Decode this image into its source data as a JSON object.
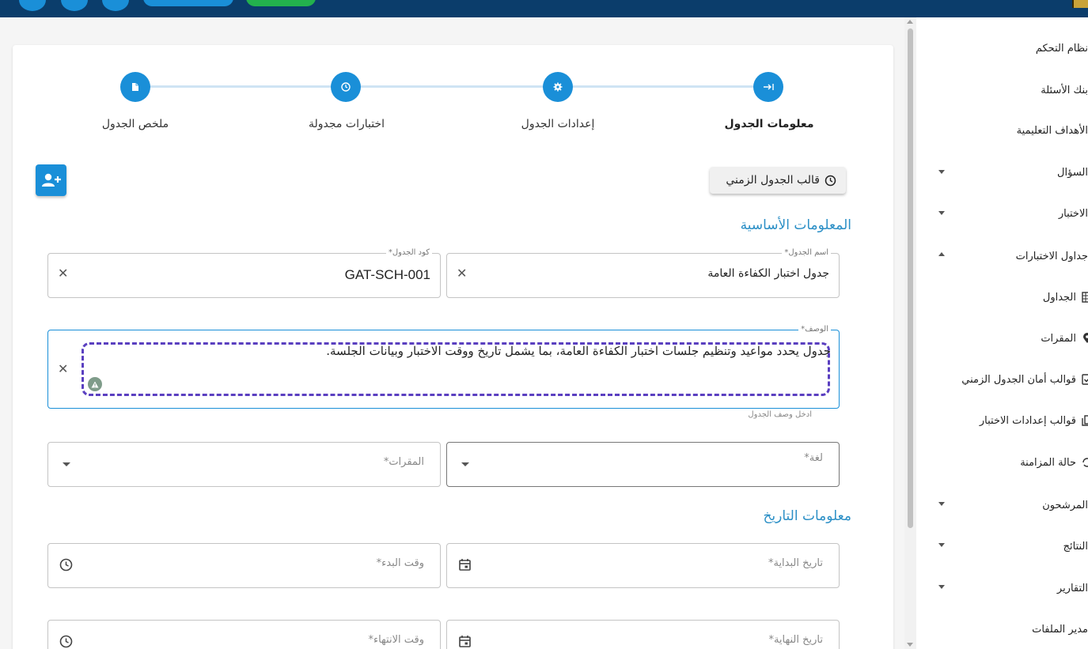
{
  "stepper": {
    "steps": [
      {
        "label": "معلومات الجدول",
        "icon": "arrow-right-to-line-icon",
        "active": true
      },
      {
        "label": "إعدادات الجدول",
        "icon": "gear-icon",
        "active": false
      },
      {
        "label": "اختبارات مجدولة",
        "icon": "clock-icon",
        "active": false
      },
      {
        "label": "ملخص الجدول",
        "icon": "document-icon",
        "active": false
      }
    ]
  },
  "toolbar": {
    "template_button_label": "قالب الجدول الزمني"
  },
  "sections": {
    "basic_info": "المعلومات الأساسية",
    "date_info": "معلومات التاريخ"
  },
  "fields": {
    "schedule_name": {
      "label": "اسم الجدول*",
      "value": "جدول اختبار الكفاءة العامة"
    },
    "schedule_code": {
      "label": "كود الجدول*",
      "value": "GAT-SCH-001"
    },
    "description": {
      "label": "الوصف*",
      "value": "جدول يحدد مواعيد وتنظيم جلسات اختبار الكفاءة العامة، بما يشمل تاريخ ووقت الاختبار وبيانات الجلسة.",
      "helper": "ادخل وصف الجدول"
    },
    "language": {
      "placeholder": "لغة*"
    },
    "venues": {
      "placeholder": "المقرات*"
    },
    "start_date": {
      "placeholder": "تاريخ البداية*"
    },
    "start_time": {
      "placeholder": "وقت البدء*"
    },
    "end_date": {
      "placeholder": "تاريخ النهاية*"
    },
    "end_time": {
      "placeholder": "وقت الانتهاء*"
    }
  },
  "sidebar": {
    "items": [
      {
        "label": "نظام التحكم"
      },
      {
        "label": "بنك الأسئلة"
      },
      {
        "label": "الأهداف التعليمية"
      },
      {
        "label": "السؤال",
        "caret": "down"
      },
      {
        "label": "الاختبار",
        "caret": "down"
      },
      {
        "label": "جداول الاختبارات",
        "caret": "up"
      },
      {
        "label": "المرشحون",
        "caret": "down"
      },
      {
        "label": "النتائج",
        "caret": "down"
      },
      {
        "label": "التقارير",
        "caret": "down"
      },
      {
        "label": "مدير الملفات"
      }
    ],
    "sub_items": [
      {
        "label": "الجداول",
        "icon": "table-icon"
      },
      {
        "label": "المقرات",
        "icon": "location-pin-icon"
      },
      {
        "label": "قوالب أمان الجدول الزمني",
        "icon": "checkbox-icon"
      },
      {
        "label": "قوالب إعدادات الاختبار",
        "icon": "copy-icon"
      },
      {
        "label": "حالة المزامنة",
        "icon": "sync-icon"
      }
    ]
  },
  "colors": {
    "primary": "#1a8fd8",
    "topbar": "#0b3d6b",
    "section_title": "#2b8fc6",
    "dashed_highlight": "#5a3fc0"
  }
}
